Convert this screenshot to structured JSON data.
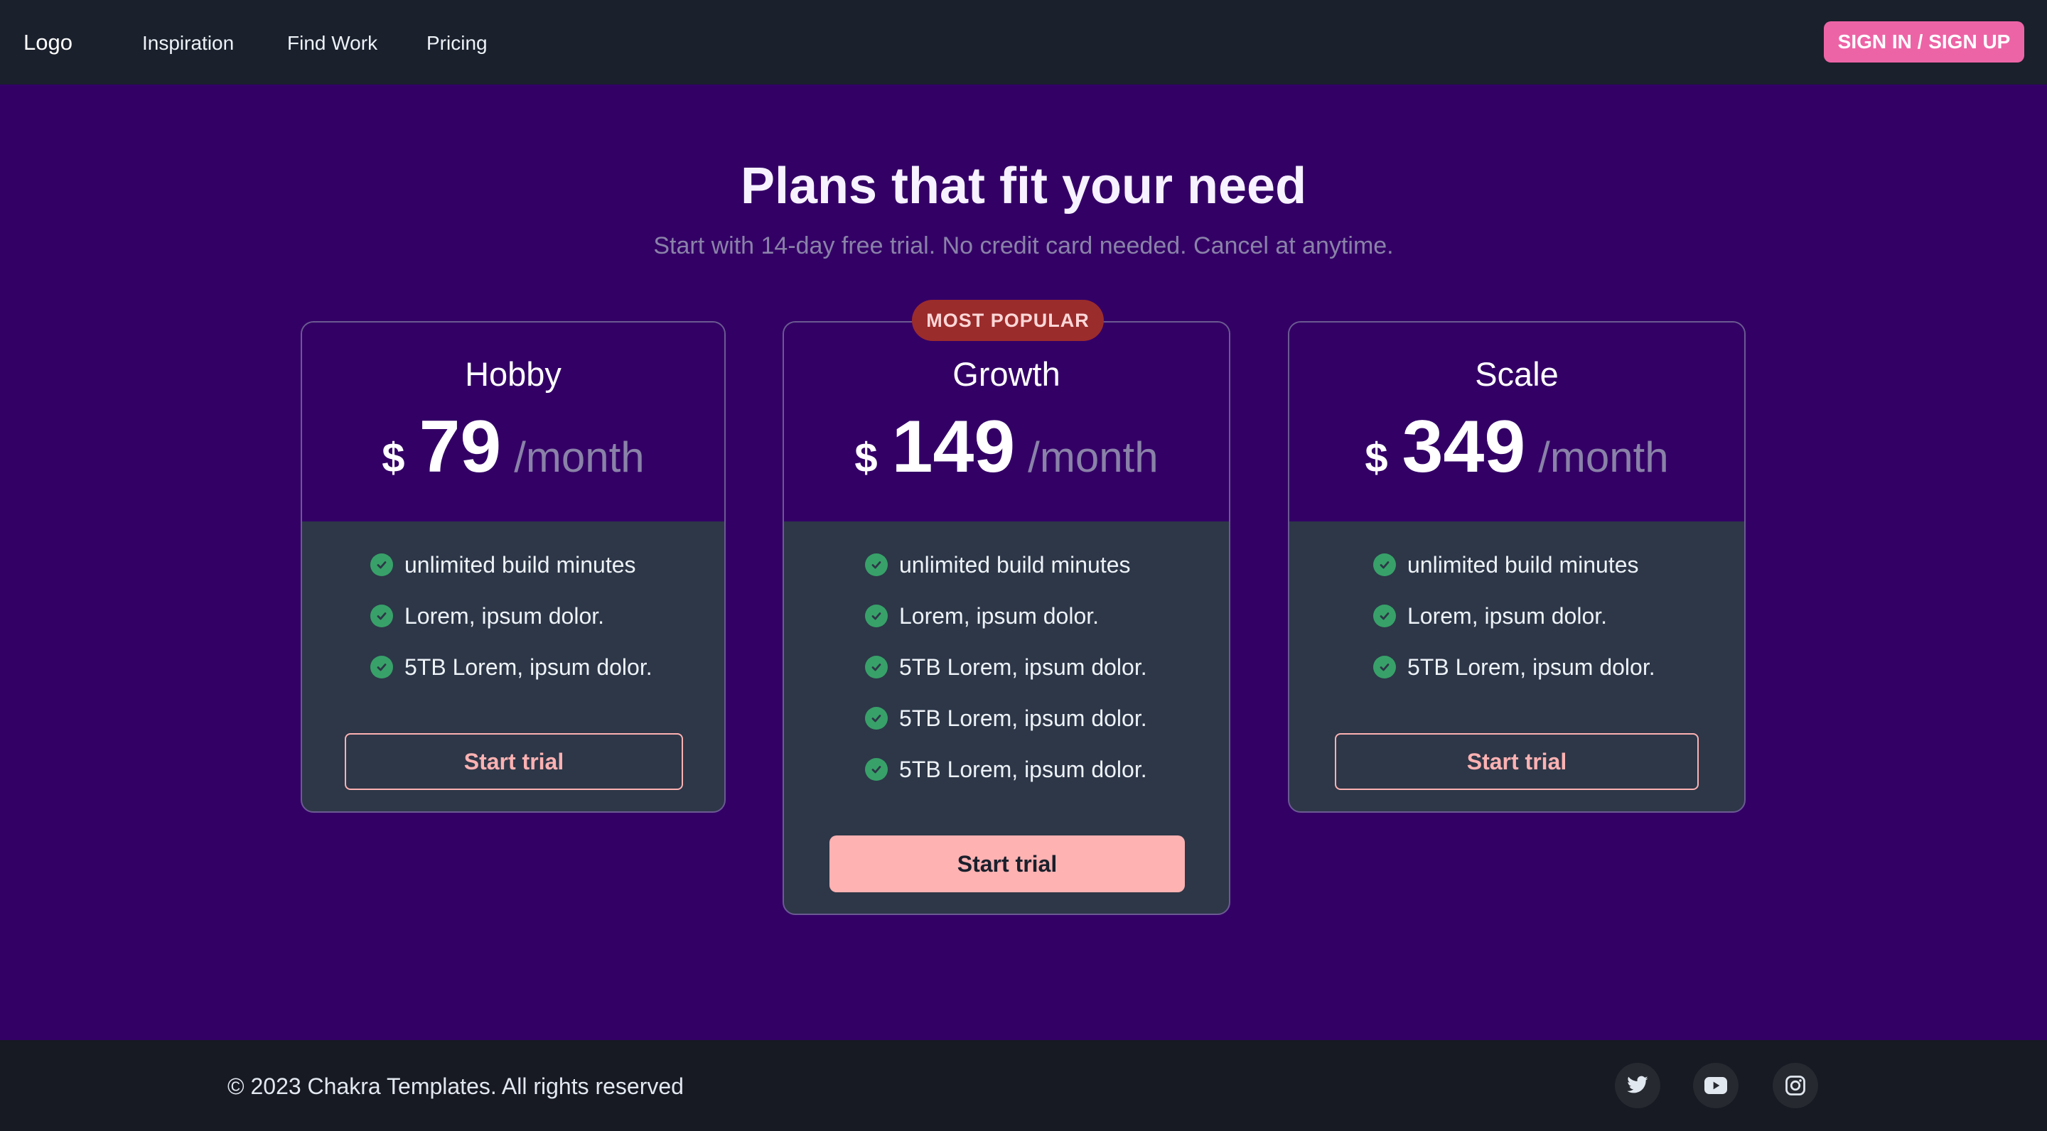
{
  "navbar": {
    "logo": "Logo",
    "links": [
      "Inspiration",
      "Find Work",
      "Pricing"
    ],
    "signin_label": "SIGN IN / SIGN UP"
  },
  "hero": {
    "title": "Plans that fit your need",
    "subtitle": "Start with 14-day free trial. No credit card needed. Cancel at anytime."
  },
  "plans": [
    {
      "name": "Hobby",
      "currency": "$",
      "price": "79",
      "period": "/month",
      "features": [
        "unlimited build minutes",
        "Lorem, ipsum dolor.",
        "5TB Lorem, ipsum dolor."
      ],
      "cta": "Start trial"
    },
    {
      "name": "Growth",
      "badge": "MOST POPULAR",
      "currency": "$",
      "price": "149",
      "period": "/month",
      "features": [
        "unlimited build minutes",
        "Lorem, ipsum dolor.",
        "5TB Lorem, ipsum dolor.",
        "5TB Lorem, ipsum dolor.",
        "5TB Lorem, ipsum dolor."
      ],
      "cta": "Start trial"
    },
    {
      "name": "Scale",
      "currency": "$",
      "price": "349",
      "period": "/month",
      "features": [
        "unlimited build minutes",
        "Lorem, ipsum dolor.",
        "5TB Lorem, ipsum dolor."
      ],
      "cta": "Start trial"
    }
  ],
  "footer": {
    "copyright": "© 2023 Chakra Templates. All rights reserved",
    "social": [
      "twitter-icon",
      "youtube-icon",
      "instagram-icon"
    ]
  },
  "colors": {
    "nav_bg": "#1a202c",
    "page_bg": "#330066",
    "card_body": "#2d3748",
    "accent_pink": "#ed64a6",
    "button_pink": "#feb2b2",
    "badge_red": "#9b2c2c",
    "check_green": "#38a169"
  }
}
